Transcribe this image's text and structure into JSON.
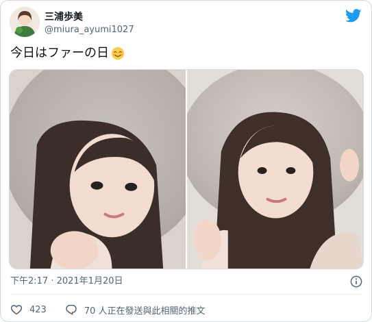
{
  "author": {
    "display_name": "三浦歩美",
    "handle": "@miura_ayumi1027"
  },
  "tweet": {
    "text": "今日はファーの日",
    "emoji": "smiling-face-with-blush-emoji"
  },
  "media": {
    "photos": [
      {
        "icon": "photo-woman-fur-hood-left"
      },
      {
        "icon": "photo-woman-fur-hood-right"
      }
    ]
  },
  "meta": {
    "timestamp": "下午2:17 · 2021年1月20日"
  },
  "actions": {
    "like_count": "423",
    "reply_label": "70 人正在發送與此相關的推文"
  },
  "colors": {
    "brand": "#1d9bf0",
    "text": "#0f1419",
    "secondary_text": "#536471",
    "border": "#cfd9de"
  }
}
